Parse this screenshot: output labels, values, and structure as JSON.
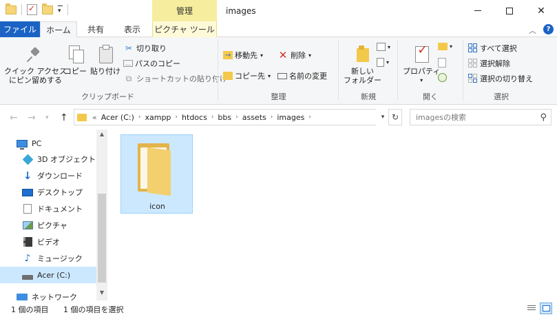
{
  "window": {
    "title": "images",
    "context_tab_group": "管理",
    "context_color": "#f6ed9e"
  },
  "ribbon_tabs": {
    "file": "ファイル",
    "home": "ホーム",
    "share": "共有",
    "view": "表示",
    "picture_tools": "ピクチャ ツール"
  },
  "ribbon": {
    "clipboard": {
      "label": "クリップボード",
      "pin_quick_access": [
        "クイック アクセス",
        "にピン留めする"
      ],
      "copy": "コピー",
      "paste": "貼り付け",
      "cut": "切り取り",
      "copy_path": "パスのコピー",
      "paste_shortcut": "ショートカットの貼り付け"
    },
    "organize": {
      "label": "整理",
      "move_to": "移動先",
      "copy_to": "コピー先",
      "delete": "削除",
      "rename": "名前の変更"
    },
    "new": {
      "label": "新規",
      "new_folder": [
        "新しい",
        "フォルダー"
      ]
    },
    "open": {
      "label": "開く",
      "properties": "プロパティ"
    },
    "select": {
      "label": "選択",
      "select_all": "すべて選択",
      "select_none": "選択解除",
      "invert_selection": "選択の切り替え"
    }
  },
  "address": {
    "overflow": "«",
    "breadcrumbs": [
      "Acer (C:)",
      "xampp",
      "htdocs",
      "bbs",
      "assets",
      "images"
    ],
    "search_placeholder": "imagesの検索"
  },
  "nav_pane": {
    "items": [
      {
        "label": "PC",
        "icon": "pc-icon"
      },
      {
        "label": "3D オブジェクト",
        "icon": "3d-objects-icon"
      },
      {
        "label": "ダウンロード",
        "icon": "download-icon"
      },
      {
        "label": "デスクトップ",
        "icon": "desktop-icon"
      },
      {
        "label": "ドキュメント",
        "icon": "documents-icon"
      },
      {
        "label": "ピクチャ",
        "icon": "pictures-icon"
      },
      {
        "label": "ビデオ",
        "icon": "videos-icon"
      },
      {
        "label": "ミュージック",
        "icon": "music-icon"
      },
      {
        "label": "Acer (C:)",
        "icon": "drive-icon",
        "selected": true
      },
      {
        "label": "ネットワーク",
        "icon": "network-icon"
      }
    ]
  },
  "content": {
    "items": [
      {
        "name": "icon",
        "type": "folder",
        "selected": true
      }
    ]
  },
  "status": {
    "item_count": "1 個の項目",
    "selected_count": "1 個の項目を選択"
  },
  "colors": {
    "file_tab": "#1a63c4",
    "selection": "#cce8ff",
    "folder": "#f3c94c"
  }
}
